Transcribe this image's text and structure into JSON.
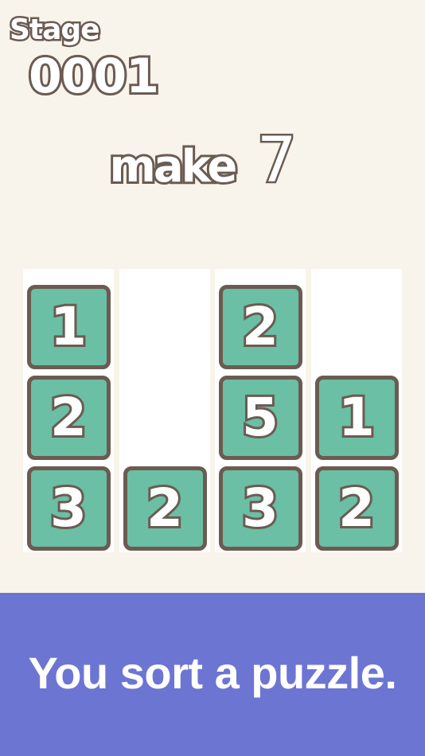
{
  "header": {
    "stage_label": "Stage",
    "stage_number": "0001"
  },
  "goal": {
    "prefix": "make",
    "target": "7"
  },
  "board": {
    "columns": [
      {
        "tiles": [
          "1",
          "2",
          "3"
        ]
      },
      {
        "tiles": [
          "2"
        ]
      },
      {
        "tiles": [
          "2",
          "5",
          "3"
        ]
      },
      {
        "tiles": [
          "1",
          "2"
        ]
      }
    ]
  },
  "banner": {
    "text": "You sort a puzzle."
  },
  "colors": {
    "background": "#f8f4eb",
    "column": "#ffffff",
    "tile": "#6bbfa4",
    "outline": "#6b5b52",
    "banner": "#6d75d3"
  }
}
